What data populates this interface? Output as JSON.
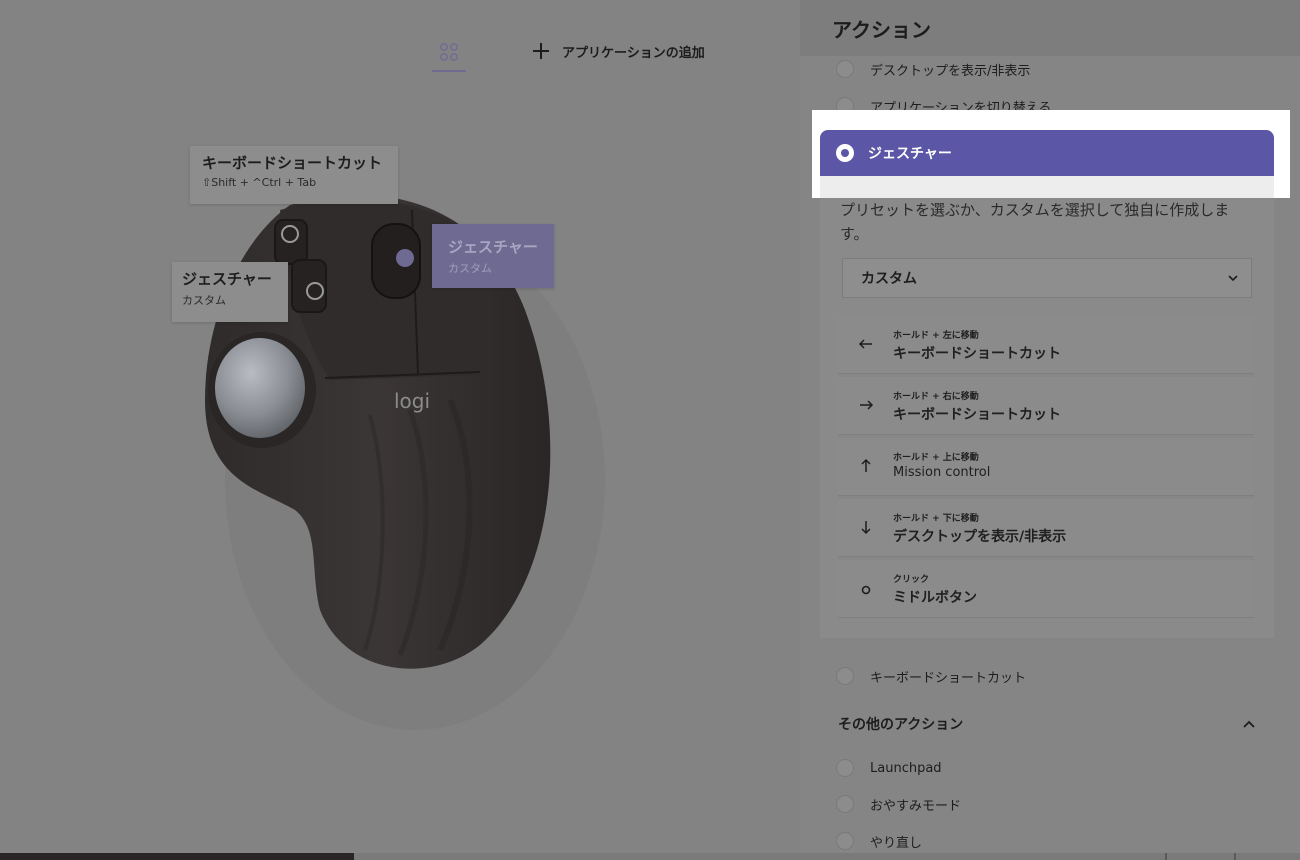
{
  "header": {
    "add_application": "アプリケーションの追加"
  },
  "callouts": {
    "keyboard_shortcut": {
      "title": "キーボードショートカット",
      "detail": "⇧Shift + ^Ctrl + Tab"
    },
    "side_gesture": {
      "title": "ジェスチャー",
      "detail": "カスタム"
    },
    "middle_gesture": {
      "title": "ジェスチャー",
      "detail": "カスタム"
    }
  },
  "mouse": {
    "brand": "logi"
  },
  "panel": {
    "title": "アクション",
    "actions_top": [
      {
        "label": "デスクトップを表示/非表示"
      },
      {
        "label": "アプリケーションを切り替える"
      }
    ],
    "selected_action": "ジェスチャー",
    "gesture": {
      "description": "プリセットを選ぶか、カスタムを選択して独自に作成します。",
      "preset_selected": "カスタム",
      "rows": [
        {
          "icon": "arrow-left-icon",
          "condition": "ホールド + 左に移動",
          "action": "キーボードショートカット"
        },
        {
          "icon": "arrow-right-icon",
          "condition": "ホールド + 右に移動",
          "action": "キーボードショートカット"
        },
        {
          "icon": "arrow-up-icon",
          "condition": "ホールド + 上に移動",
          "action": "Mission control"
        },
        {
          "icon": "arrow-down-icon",
          "condition": "ホールド + 下に移動",
          "action": "デスクトップを表示/非表示"
        },
        {
          "icon": "circle-icon",
          "condition": "クリック",
          "action": "ミドルボタン"
        }
      ]
    },
    "action_after": "キーボードショートカット",
    "other_actions": {
      "heading": "その他のアクション",
      "items": [
        {
          "label": "Launchpad"
        },
        {
          "label": "おやすみモード"
        },
        {
          "label": "やり直し"
        }
      ]
    }
  },
  "colors": {
    "accent": "#5b56a6",
    "overlay_bg": "#838383",
    "highlight": "#ffffff"
  }
}
